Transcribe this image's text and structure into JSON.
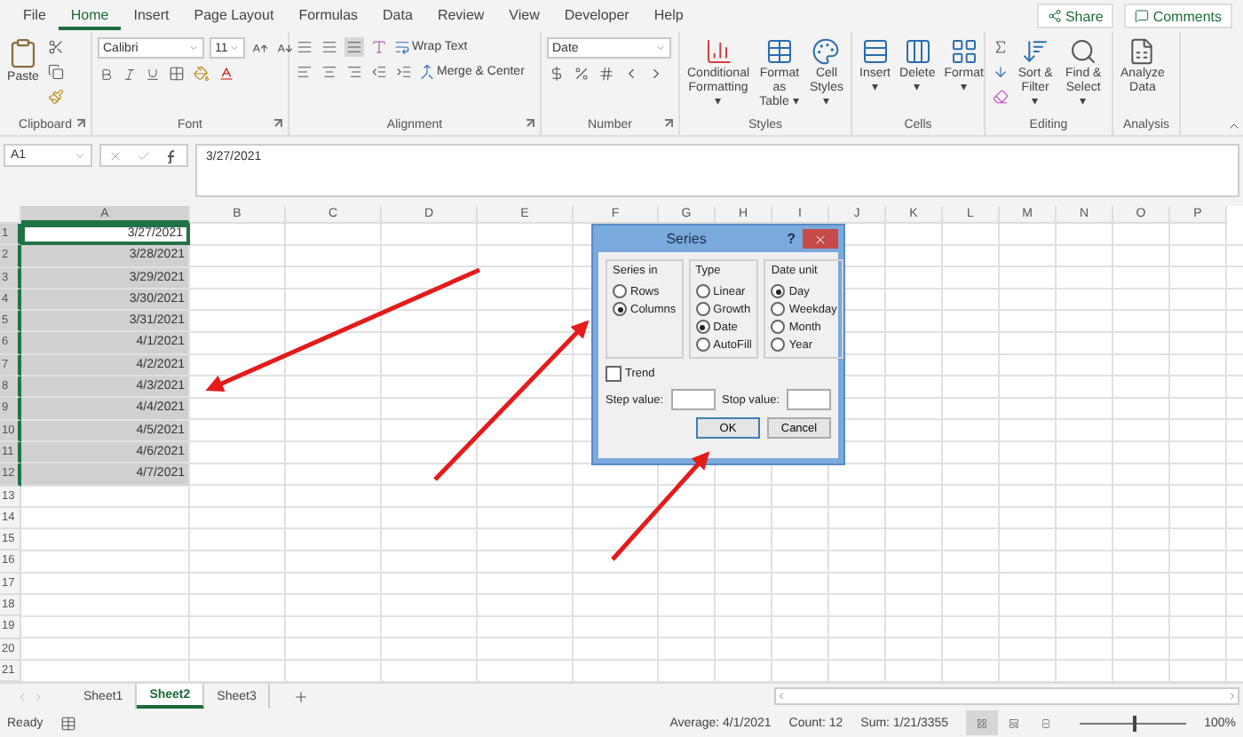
{
  "menu_tabs": [
    {
      "label": "File",
      "selected": false
    },
    {
      "label": "Home",
      "selected": true
    },
    {
      "label": "Insert",
      "selected": false
    },
    {
      "label": "Page Layout",
      "selected": false
    },
    {
      "label": "Formulas",
      "selected": false
    },
    {
      "label": "Data",
      "selected": false
    },
    {
      "label": "Review",
      "selected": false
    },
    {
      "label": "View",
      "selected": false
    },
    {
      "label": "Developer",
      "selected": false
    },
    {
      "label": "Help",
      "selected": false
    }
  ],
  "share": "Share",
  "comments": "Comments",
  "ribbon": {
    "paste": "Paste",
    "font_name": "Calibri",
    "font_size": "11",
    "wrap_text": "Wrap Text",
    "merge_center": "Merge & Center",
    "number_format": "Date",
    "styles_buttons": [
      "Conditional\nFormatting ▾",
      "Format as\nTable ▾",
      "Cell\nStyles ▾"
    ],
    "cells_buttons": [
      "Insert\n▾",
      "Delete\n▾",
      "Format\n▾"
    ],
    "editing_buttons": [
      "Sort &\nFilter ▾",
      "Find &\nSelect ▾"
    ],
    "analysis_button": "Analyze\nData",
    "groups": [
      {
        "label": "Clipboard",
        "launcher": true
      },
      {
        "label": "Font",
        "launcher": true
      },
      {
        "label": "Alignment",
        "launcher": true
      },
      {
        "label": "Number",
        "launcher": true
      },
      {
        "label": "Styles",
        "launcher": false
      },
      {
        "label": "Cells",
        "launcher": false
      },
      {
        "label": "Editing",
        "launcher": false
      },
      {
        "label": "Analysis",
        "launcher": false
      }
    ]
  },
  "name_box": "A1",
  "formula": "3/27/2021",
  "columns": [
    {
      "label": "A",
      "selected": true
    },
    {
      "label": "B",
      "selected": false
    },
    {
      "label": "C",
      "selected": false
    },
    {
      "label": "D",
      "selected": false
    },
    {
      "label": "E",
      "selected": false
    },
    {
      "label": "F",
      "selected": false
    },
    {
      "label": "G",
      "selected": false
    },
    {
      "label": "H",
      "selected": false
    },
    {
      "label": "I",
      "selected": false
    },
    {
      "label": "J",
      "selected": false
    },
    {
      "label": "K",
      "selected": false
    },
    {
      "label": "L",
      "selected": false
    },
    {
      "label": "M",
      "selected": false
    },
    {
      "label": "N",
      "selected": false
    },
    {
      "label": "O",
      "selected": false
    },
    {
      "label": "P",
      "selected": false
    }
  ],
  "rows": [
    {
      "number": "1",
      "selected": true,
      "active": true,
      "a": "3/27/2021"
    },
    {
      "number": "2",
      "selected": true,
      "active": false,
      "a": "3/28/2021"
    },
    {
      "number": "3",
      "selected": true,
      "active": false,
      "a": "3/29/2021"
    },
    {
      "number": "4",
      "selected": true,
      "active": false,
      "a": "3/30/2021"
    },
    {
      "number": "5",
      "selected": true,
      "active": false,
      "a": "3/31/2021"
    },
    {
      "number": "6",
      "selected": true,
      "active": false,
      "a": "4/1/2021"
    },
    {
      "number": "7",
      "selected": true,
      "active": false,
      "a": "4/2/2021"
    },
    {
      "number": "8",
      "selected": true,
      "active": false,
      "a": "4/3/2021"
    },
    {
      "number": "9",
      "selected": true,
      "active": false,
      "a": "4/4/2021"
    },
    {
      "number": "10",
      "selected": true,
      "active": false,
      "a": "4/5/2021"
    },
    {
      "number": "11",
      "selected": true,
      "active": false,
      "a": "4/6/2021"
    },
    {
      "number": "12",
      "selected": true,
      "active": false,
      "a": "4/7/2021"
    },
    {
      "number": "13",
      "selected": false,
      "active": false
    },
    {
      "number": "14",
      "selected": false,
      "active": false
    },
    {
      "number": "15",
      "selected": false,
      "active": false
    },
    {
      "number": "16",
      "selected": false,
      "active": false
    },
    {
      "number": "17",
      "selected": false,
      "active": false
    },
    {
      "number": "18",
      "selected": false,
      "active": false
    },
    {
      "number": "19",
      "selected": false,
      "active": false
    },
    {
      "number": "20",
      "selected": false,
      "active": false
    },
    {
      "number": "21",
      "selected": false,
      "active": false
    }
  ],
  "dialog": {
    "title": "Series",
    "help": "?",
    "groups": [
      {
        "label": "Series in",
        "options": [
          {
            "label": "Rows",
            "selected": false
          },
          {
            "label": "Columns",
            "selected": true
          }
        ]
      },
      {
        "label": "Type",
        "options": [
          {
            "label": "Linear",
            "selected": false
          },
          {
            "label": "Growth",
            "selected": false
          },
          {
            "label": "Date",
            "selected": true
          },
          {
            "label": "AutoFill",
            "selected": false
          }
        ]
      },
      {
        "label": "Date unit",
        "options": [
          {
            "label": "Day",
            "selected": true
          },
          {
            "label": "Weekday",
            "selected": false
          },
          {
            "label": "Month",
            "selected": false
          },
          {
            "label": "Year",
            "selected": false
          }
        ]
      }
    ],
    "trend": {
      "label": "Trend",
      "checked": false
    },
    "step_label": "Step value:",
    "stop_label": "Stop value:",
    "buttons": [
      "OK",
      "Cancel"
    ]
  },
  "sheet_tabs": [
    {
      "label": "Sheet1",
      "selected": false
    },
    {
      "label": "Sheet2",
      "selected": true
    },
    {
      "label": "Sheet3",
      "selected": false
    }
  ],
  "status": {
    "ready": "Ready",
    "stats": [
      "Average: 4/1/2021",
      "Count: 12",
      "Sum: 1/21/3355"
    ],
    "views": [
      {
        "kind": "normal",
        "selected": true
      },
      {
        "kind": "page_layout",
        "selected": false
      },
      {
        "kind": "page_break",
        "selected": false
      }
    ],
    "zoom": {
      "level": 0.5,
      "label": "100%"
    }
  }
}
